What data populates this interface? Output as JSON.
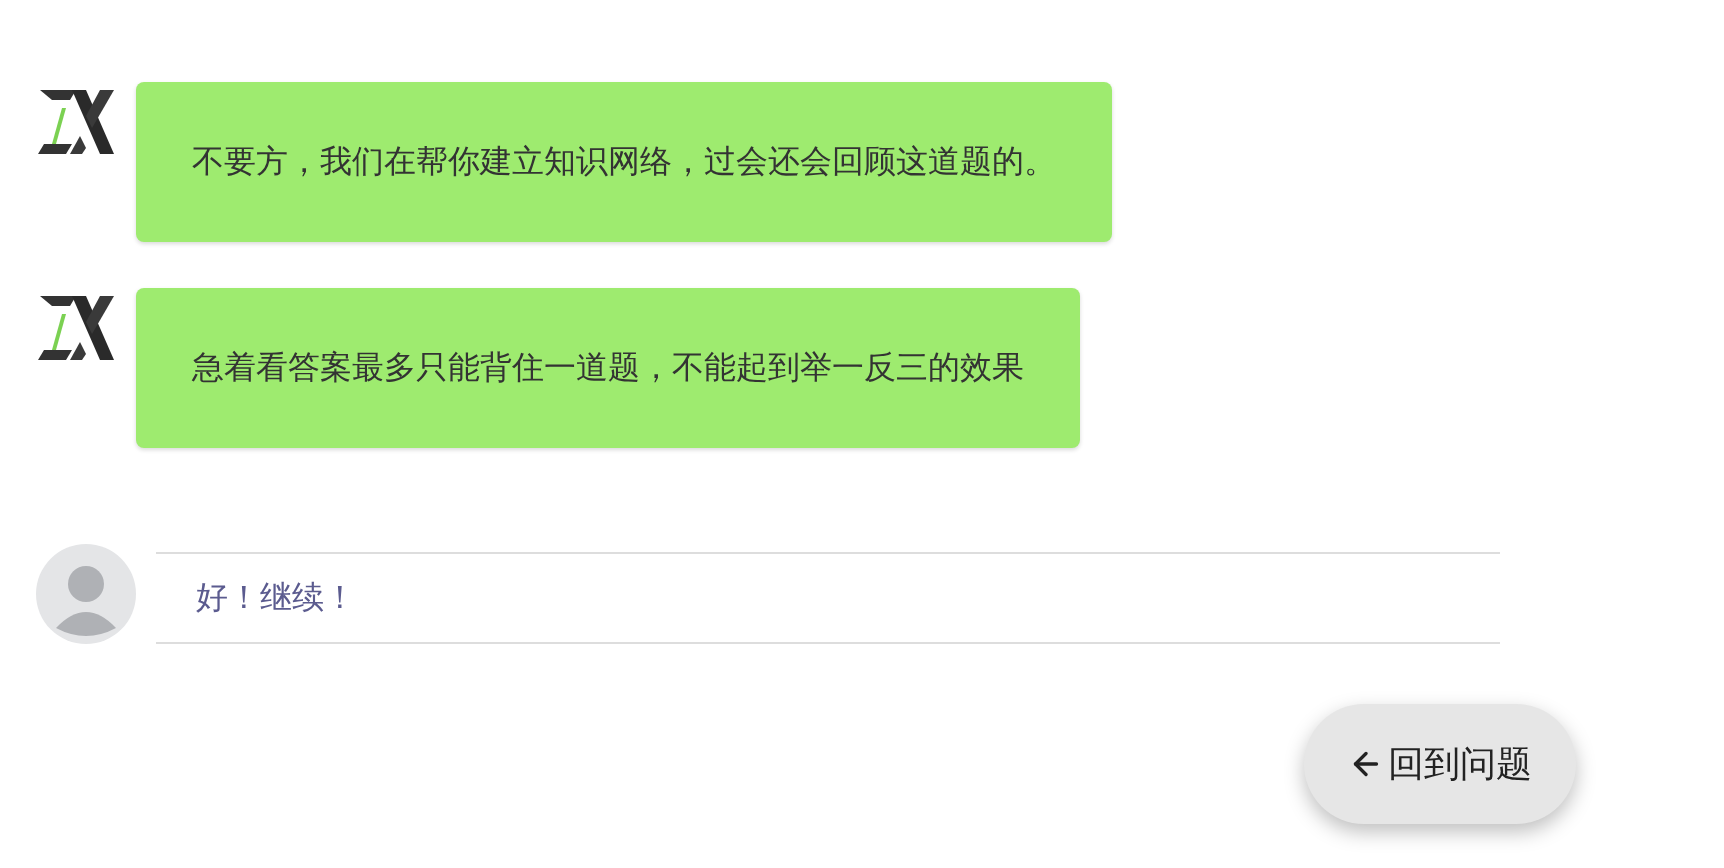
{
  "messages": [
    {
      "text": "不要方，我们在帮你建立知识网络，过会还会回顾这道题的。"
    },
    {
      "text": "急着看答案最多只能背住一道题，不能起到举一反三的效果"
    }
  ],
  "reply": {
    "text": "好！继续！"
  },
  "back_button": {
    "label": "回到问题"
  }
}
